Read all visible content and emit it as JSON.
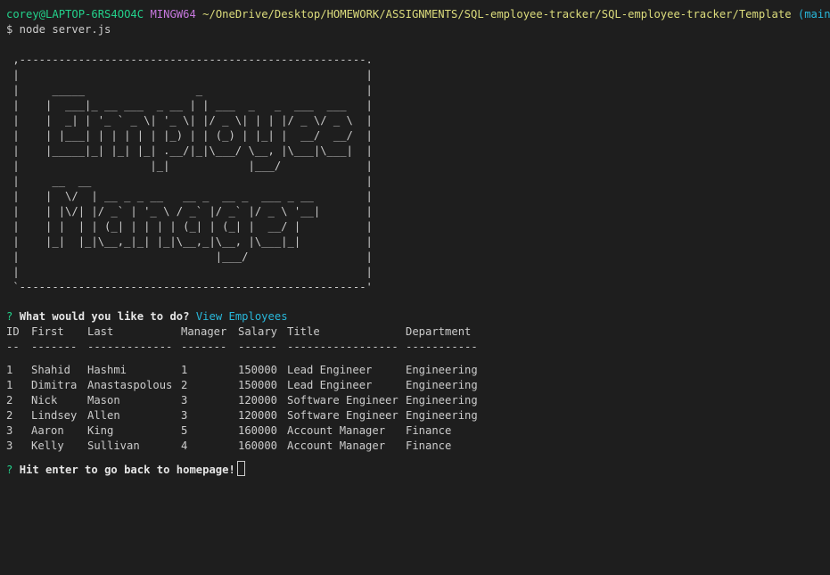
{
  "prompt": {
    "user_host": "corey@LAPTOP-6RS4OO4C",
    "shell": "MINGW64",
    "path": "~/OneDrive/Desktop/HOMEWORK/ASSIGNMENTS/SQL-employee-tracker/SQL-employee-tracker/Template",
    "branch": "(main)",
    "command": "$ node server.js"
  },
  "banner": " ,-----------------------------------------------------.\n |                                                     |\n |     _____                 _                         |\n |    |  ___|_ __ ___  _ __ | | ___  _   _  ___  ___   |\n |    |  _| | '_ ` _ \\| '_ \\| |/ _ \\| | | |/ _ \\/ _ \\  |\n |    | |___| | | | | | |_) | | (_) | |_| |  __/  __/  |\n |    |_____|_| |_| |_| .__/|_|\\___/ \\__, |\\___|\\___|  |\n |                    |_|            |___/             |\n |     __  __                                          |\n |    |  \\/  | __ _ _ __   __ _  __ _  ___ _ __        |\n |    | |\\/| |/ _` | '_ \\ / _` |/ _` |/ _ \\ '__|       |\n |    | |  | | (_| | | | | (_| | (_| |  __/ |          |\n |    |_|  |_|\\__,_|_| |_|\\__,_|\\__, |\\___|_|          |\n |                              |___/                  |\n |                                                     |\n `-----------------------------------------------------'",
  "question": {
    "mark": "?",
    "text": "What would you like to do?",
    "answer": "View Employees"
  },
  "table": {
    "headers": [
      "ID",
      "First",
      "Last",
      "Manager",
      "Salary",
      "Title",
      "Department"
    ],
    "dividers": [
      "--",
      "-------",
      "-------------",
      "-------",
      "------",
      "-----------------",
      "-----------"
    ],
    "rows": [
      [
        "1",
        "Shahid",
        "Hashmi",
        "1",
        "150000",
        "Lead Engineer",
        "Engineering"
      ],
      [
        "1",
        "Dimitra",
        "Anastaspolous",
        "2",
        "150000",
        "Lead Engineer",
        "Engineering"
      ],
      [
        "2",
        "Nick",
        "Mason",
        "3",
        "120000",
        "Software Engineer",
        "Engineering"
      ],
      [
        "2",
        "Lindsey",
        "Allen",
        "3",
        "120000",
        "Software Engineer",
        "Engineering"
      ],
      [
        "3",
        "Aaron",
        "King",
        "5",
        "160000",
        "Account Manager",
        "Finance"
      ],
      [
        "3",
        "Kelly",
        "Sullivan",
        "4",
        "160000",
        "Account Manager",
        "Finance"
      ]
    ]
  },
  "footer": {
    "mark": "?",
    "text": "Hit enter to go back to homepage!"
  }
}
